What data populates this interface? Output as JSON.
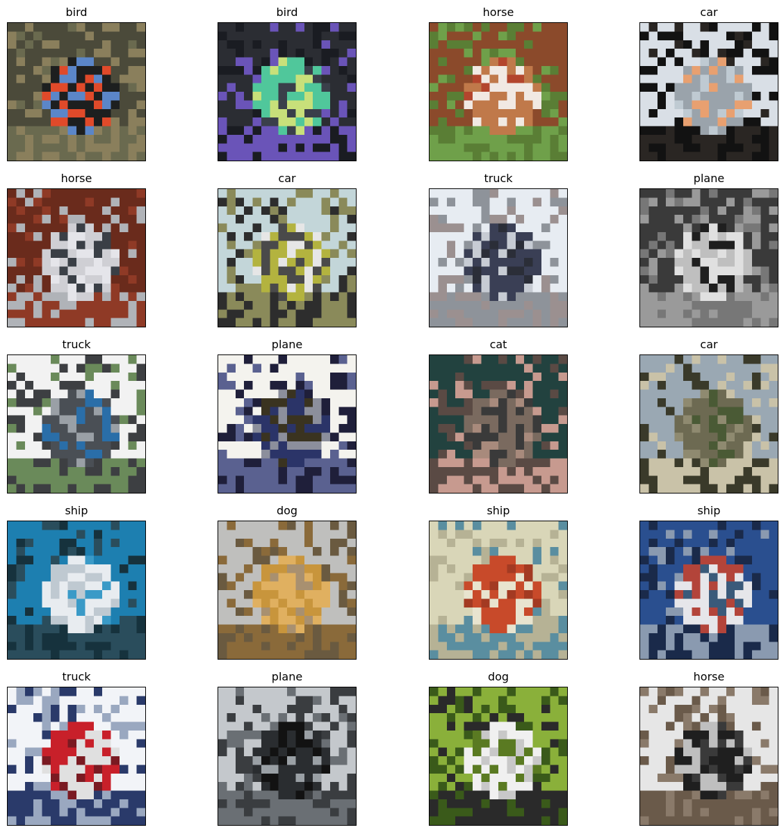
{
  "panels": [
    {
      "label": "bird",
      "palette": [
        "#4b4a3a",
        "#1d1f1f",
        "#6a6a4f",
        "#e04a2a",
        "#5b86c8",
        "#8a7f5c"
      ]
    },
    {
      "label": "bird",
      "palette": [
        "#2b2d33",
        "#50c79b",
        "#6a54b8",
        "#3a3f4a",
        "#c8e07a",
        "#1a1c22"
      ]
    },
    {
      "label": "horse",
      "palette": [
        "#8b4a2b",
        "#c0794a",
        "#6fa04a",
        "#f1e9e3",
        "#b3452d",
        "#5a7e35"
      ]
    },
    {
      "label": "car",
      "palette": [
        "#d9dfe6",
        "#9aa3ab",
        "#2a2623",
        "#e8a070",
        "#bfcad2",
        "#121212"
      ]
    },
    {
      "label": "horse",
      "palette": [
        "#6a2b1c",
        "#cfcfd4",
        "#8f3a26",
        "#e5e5ea",
        "#3a3f46",
        "#b0b3b8"
      ]
    },
    {
      "label": "car",
      "palette": [
        "#c3d6d9",
        "#b3b33f",
        "#2d2d2d",
        "#e6e6e6",
        "#4a4a4a",
        "#8a8a5a"
      ]
    },
    {
      "label": "truck",
      "palette": [
        "#e7ecf2",
        "#3a3f55",
        "#8e939a",
        "#c7ccd4",
        "#2b2e38",
        "#9b9090"
      ]
    },
    {
      "label": "plane",
      "palette": [
        "#3a3a3a",
        "#e0e0e0",
        "#777777",
        "#bfbfbf",
        "#1f1f1f",
        "#9a9a9a"
      ]
    },
    {
      "label": "truck",
      "palette": [
        "#f2f2f2",
        "#4a4f55",
        "#6a8a5a",
        "#2a6ea8",
        "#9aa0a6",
        "#3d3f42"
      ]
    },
    {
      "label": "plane",
      "palette": [
        "#f4f3ee",
        "#2b3468",
        "#5a6190",
        "#3a3320",
        "#8c8f9c",
        "#1f1f3a"
      ]
    },
    {
      "label": "cat",
      "palette": [
        "#22423f",
        "#7a6a5f",
        "#c79a8f",
        "#3a3a3a",
        "#a88a7c",
        "#5a4a44"
      ]
    },
    {
      "label": "car",
      "palette": [
        "#9aa8b3",
        "#6d6a52",
        "#c9c2a8",
        "#4a5a35",
        "#8f8a70",
        "#3a3a2a"
      ]
    },
    {
      "label": "ship",
      "palette": [
        "#1d7fb0",
        "#e8ecf0",
        "#2a4d5c",
        "#bfc9d1",
        "#3a9ac7",
        "#16323d"
      ]
    },
    {
      "label": "dog",
      "palette": [
        "#bfbfbd",
        "#c8953c",
        "#8a6a3a",
        "#e0b060",
        "#a89070",
        "#6a5a40"
      ]
    },
    {
      "label": "ship",
      "palette": [
        "#d9d6b8",
        "#c84a2a",
        "#5a8ea0",
        "#e8e4cf",
        "#a33a22",
        "#b6b295"
      ]
    },
    {
      "label": "ship",
      "palette": [
        "#2a4f8f",
        "#e6e6ea",
        "#8a9ab0",
        "#b3443a",
        "#3a5a7a",
        "#1a2a4a"
      ]
    },
    {
      "label": "truck",
      "palette": [
        "#f2f4f8",
        "#c8202a",
        "#2a3a6a",
        "#e0e0e0",
        "#7a1a22",
        "#9aa8c0"
      ]
    },
    {
      "label": "plane",
      "palette": [
        "#c4c8cc",
        "#2a2d30",
        "#6a6f74",
        "#121212",
        "#9aa0a5",
        "#3a3d40"
      ]
    },
    {
      "label": "dog",
      "palette": [
        "#8ab03a",
        "#f0f0f0",
        "#2a2a2a",
        "#c8c8c8",
        "#5a7a22",
        "#3a5a1a"
      ]
    },
    {
      "label": "horse",
      "palette": [
        "#e6e6e6",
        "#1f1f1f",
        "#6a5a4a",
        "#bfbfbf",
        "#3a3a3a",
        "#8a7a6a"
      ]
    }
  ]
}
